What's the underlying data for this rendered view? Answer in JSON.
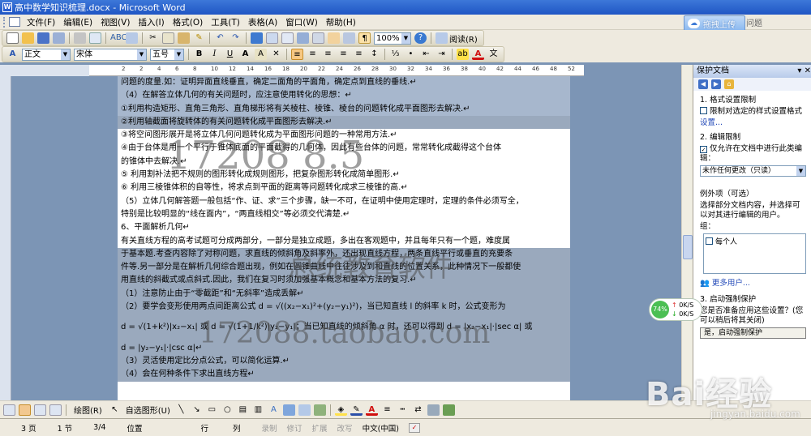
{
  "window": {
    "title": "高中数学知识梳理.docx - Microsoft Word",
    "app_icon": "W"
  },
  "menubar": {
    "items": [
      "文件(F)",
      "编辑(E)",
      "视图(V)",
      "插入(I)",
      "格式(O)",
      "工具(T)",
      "表格(A)",
      "窗口(W)",
      "帮助(H)"
    ],
    "question": "问题"
  },
  "upload_button": {
    "label": "拖拽上传"
  },
  "toolbar1": {
    "zoom": "100%",
    "read_label": "阅读(R)"
  },
  "toolbar2": {
    "style": "正文",
    "font": "宋体",
    "size": "五号",
    "bold": "B",
    "italic": "I",
    "underline": "U",
    "font_color": "A"
  },
  "ruler": {
    "ticks": [
      "2",
      "2",
      "4",
      "6",
      "8",
      "10",
      "12",
      "14",
      "16",
      "18",
      "20",
      "22",
      "24",
      "26",
      "28",
      "30",
      "32",
      "34",
      "36",
      "38",
      "40",
      "42",
      "44",
      "46",
      "48",
      "52"
    ]
  },
  "document": {
    "lines": [
      {
        "text": "问题的度量.如：证明异面直线垂直，确定二面角的平面角，确定点到直线的垂线.↵",
        "hl": 1
      },
      {
        "text": "（4）在解答立体几何的有关问题时，应注意使用转化的思想：↵",
        "hl": 1
      },
      {
        "text": "        ①利用构造矩形、直角三角形、直角梯形将有关棱柱、棱锥、棱台的问题转化成平面图形去解决.↵",
        "hl": 1
      },
      {
        "text": "        ②利用轴截面将旋转体的有关问题转化成平面图形去解决.↵",
        "hl": 2
      },
      {
        "text": "        ③将空间图形展开是将立体几何问题转化成为平面图形问题的一种常用方法.↵",
        "hl": 0
      },
      {
        "text": "        ④由于台体是用一个平行于锥体底面的平面截得的几何体，因此有些台体的问题，常常转化成截得这个台体",
        "hl": 0
      },
      {
        "text": "的锥体中去解决.↵",
        "hl": 0
      },
      {
        "text": "        ⑤  利用割补法把不规则的图形转化成规则图形，把复杂图形转化成简单图形.↵",
        "hl": 0
      },
      {
        "text": "        ⑥  利用三棱锥体积的自等性，将求点到平面的距离等问题转化成求三棱锥的高.↵",
        "hl": 0
      },
      {
        "text": "（5）立体几何解答题一般包括“作、证、求”三个步骤，缺一不可，在证明中使用定理时，定理的条件必须写全，",
        "hl": 0
      },
      {
        "text": "特别是比较明显的“线在面内”，“两直线相交”等必须交代清楚.↵",
        "hl": 0
      },
      {
        "text": "6、平面解析几何↵",
        "hl": 0
      },
      {
        "text": "        有关直线方程的高考试题可分成两部分，一部分是独立成题，多出在客观题中，并且每年只有一个题，难度属",
        "hl": 0
      },
      {
        "text": "于基本题.考查内容除了对称问题，求直线的倾斜角及斜率外，还出现直线方程，两条直线平行或垂直的充要条",
        "hl": 2
      },
      {
        "text": "件等.另一部分是在解析几何综合题出现，例如在圆锥曲线中往往涉及到和直线的位置关系，此种情况下一般都使",
        "hl": 2
      },
      {
        "text": "用直线的斜截式或点斜式.因此，我们在复习时须加强基本概念和基本方法的复习.↵",
        "hl": 2
      },
      {
        "text": "（1）注意防止由于“零截距”和“无斜率”造成丢解↵",
        "hl": 2
      },
      {
        "text": "（2）要学会变形使用两点间距离公式 d = √((x₂−x₁)²+(y₂−y₁)²)，当已知直线 l 的斜率 k 时，公式变形为",
        "hl": 2
      },
      {
        "text": "",
        "hl": 2
      },
      {
        "text": "d = √(1+k²)|x₂−x₁| 或 d = √(1+1/k²)|y₂−y₁|；当已知直线的倾斜角 α 时，还可以得到 d = |x₂−x₁|·|sec α| 或",
        "hl": 2
      },
      {
        "text": "",
        "hl": 2
      },
      {
        "text": "d = |y₂−y₁|·|csc α|↵",
        "hl": 2
      },
      {
        "text": "（3）灵活使用定比分点公式，可以简化运算.↵",
        "hl": 2
      },
      {
        "text": "（4）会在何种条件下求出直线方程↵",
        "hl": 2
      }
    ],
    "watermarks": [
      "17208  8.5",
      "总统教育软件",
      "172088.taobao.com"
    ]
  },
  "pane": {
    "title": "保护文档",
    "sec1_title": "1. 格式设置限制",
    "sec1_check": "限制对选定的样式设置格式",
    "sec1_link": "设置...",
    "sec2_title": "2. 编辑限制",
    "sec2_check": "仅允许在文档中进行此类编辑：",
    "sec2_select": "未作任何更改（只读）",
    "exceptions_title": "例外项（可选）",
    "exceptions_desc": "选择部分文档内容，并选择可以对其进行编辑的用户。",
    "group_label": "组：",
    "group_item": "每个人",
    "more_users": "更多用户...",
    "sec3_title": "3. 启动强制保护",
    "sec3_desc": "您是否准备应用这些设置？(您可以稍后将其关闭)",
    "sec3_button": "是，启动强制保护"
  },
  "netspeed": {
    "percent": "74%",
    "up": "0K/S",
    "down": "0K/S"
  },
  "drawbar": {
    "draw_label": "绘图(R)",
    "autoshape_label": "自选图形(U)"
  },
  "statusbar": {
    "page": "3 页",
    "section": "1 节",
    "pages": "3/4",
    "position": "位置",
    "line": "行",
    "col": "列",
    "rec": "录制",
    "trk": "修订",
    "ext": "扩展",
    "ovr": "改写",
    "lang": "中文(中国)"
  },
  "baidu_logo": {
    "text": "Bai经验",
    "url": "jingyan.baidu.com"
  }
}
